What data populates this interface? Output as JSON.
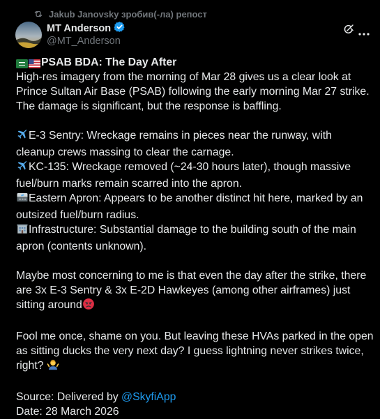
{
  "repost": {
    "text": "Jakub Janovsky зробив(-ла) репост",
    "icon": "repost-icon"
  },
  "author": {
    "name": "MT Anderson",
    "handle": "@MT_Anderson",
    "verified": true,
    "badge_color": "#1d9bf0"
  },
  "actions": {
    "grok_icon": "grok-icon",
    "more_icon": "more-icon"
  },
  "post": {
    "title": "PSAB BDA: The Day After",
    "title_flags": [
      "saudi-flag-emoji",
      "us-flag-emoji"
    ],
    "intro": [
      "High-res imagery from the morning of Mar 28 gives us a clear look at",
      "Prince Sultan Air Base (PSAB) following the early morning Mar 27 strike.",
      "The damage is significant, but the response is baffling."
    ],
    "items": {
      "e3": [
        "E-3 Sentry: Wreckage remains in pieces near the runway, with",
        "cleanup crews massing to clear the carnage."
      ],
      "kc135": [
        "KC-135: Wreckage removed (~24-30 hours later), though massive",
        "fuel/burn marks remain scarred into the apron."
      ],
      "eastern": [
        "Eastern Apron: Appears to be another distinct hit here, marked by an",
        "outsized fuel/burn radius."
      ],
      "infra": [
        "Infrastructure: Substantial damage to the building south of the main",
        "apron (contents unknown)."
      ]
    },
    "concern": [
      "Maybe most concerning to me is that even the day after the strike, there",
      "are 3x E-3 Sentry & 3x E-2D Hawkeyes (among other airframes) just",
      "sitting around"
    ],
    "fool": [
      "Fool me once, shame on you. But leaving these HVAs parked in the open",
      "as sitting ducks the very next day? I guess lightning never strikes twice,",
      "right?"
    ],
    "source_prefix": "Source: Delivered by ",
    "source_link": "@SkyfiApp",
    "date": "Date: 28 March 2026"
  },
  "colors": {
    "background": "#000000",
    "text": "#e7e9ea",
    "secondary": "#71767b",
    "link": "#1d9bf0"
  }
}
